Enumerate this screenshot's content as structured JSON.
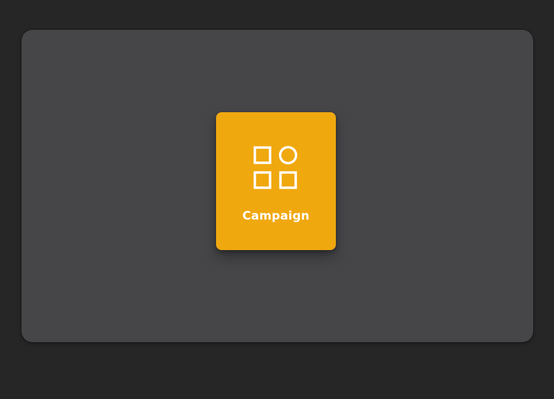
{
  "colors": {
    "background": "#262627",
    "panel": "#464548",
    "accent": "#f0a80f",
    "icon": "#ffffff",
    "label": "#ffffff"
  },
  "tile": {
    "label": "Campaign",
    "icon": "apps-grid-icon"
  }
}
